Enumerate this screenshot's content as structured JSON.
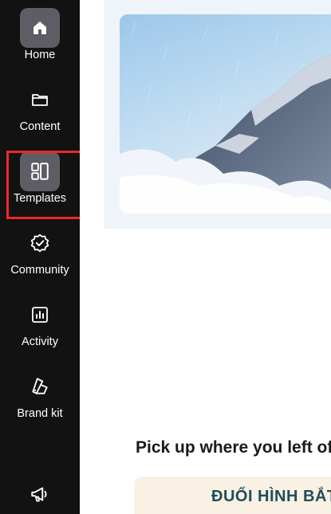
{
  "sidebar": {
    "items": [
      {
        "label": "Home",
        "icon": "home-icon"
      },
      {
        "label": "Content",
        "icon": "folder-icon"
      },
      {
        "label": "Templates",
        "icon": "templates-icon",
        "active": true
      },
      {
        "label": "Community",
        "icon": "verified-badge-icon"
      },
      {
        "label": "Activity",
        "icon": "bar-chart-icon"
      },
      {
        "label": "Brand kit",
        "icon": "brand-kit-icon"
      },
      {
        "label": "",
        "icon": "megaphone-icon"
      }
    ]
  },
  "main": {
    "recent_title": "Pick up where you left off",
    "recent_card_text": "ĐUỔI HÌNH BẮT"
  },
  "colors": {
    "sidebar_bg": "#121212",
    "active_bg": "#5e5d65",
    "highlight": "#f0262a"
  }
}
